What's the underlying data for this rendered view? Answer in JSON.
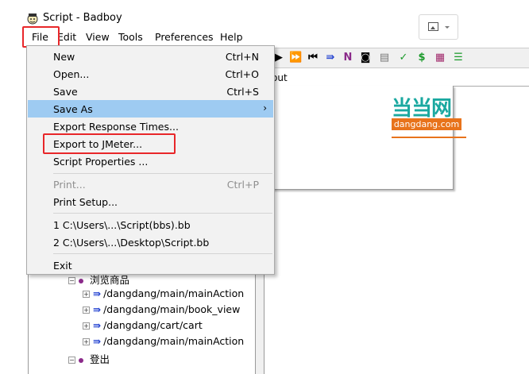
{
  "window": {
    "title": "Script - Badboy"
  },
  "menubar": {
    "file": "File",
    "edit": "Edit",
    "view": "View",
    "tools": "Tools",
    "preferences": "Preferences",
    "help": "Help"
  },
  "file_menu": {
    "items": [
      {
        "label": "New",
        "shortcut": "Ctrl+N"
      },
      {
        "label": "Open...",
        "shortcut": "Ctrl+O"
      },
      {
        "label": "Save",
        "shortcut": "Ctrl+S"
      },
      {
        "label": "Save As",
        "shortcut": ""
      },
      {
        "label": "Export Response Times...",
        "shortcut": ""
      },
      {
        "label": "Export to JMeter...",
        "shortcut": ""
      },
      {
        "label": "Script Properties ...",
        "shortcut": ""
      },
      {
        "label": "Print...",
        "shortcut": "Ctrl+P"
      },
      {
        "label": "Print Setup...",
        "shortcut": ""
      },
      {
        "label": "1 C:\\Users\\...\\Script(bbs).bb",
        "shortcut": ""
      },
      {
        "label": "2 C:\\Users\\...\\Desktop\\Script.bb",
        "shortcut": ""
      },
      {
        "label": "Exit",
        "shortcut": ""
      }
    ],
    "submenu_arrow": "›"
  },
  "tab": {
    "label": "out"
  },
  "logo": {
    "cn": "当当网",
    "en": "dangdang.com"
  },
  "tree": {
    "rows": [
      {
        "label": "浏览商品",
        "type": "group"
      },
      {
        "label": "/dangdang/main/mainAction",
        "type": "request"
      },
      {
        "label": "/dangdang/main/book_view",
        "type": "request"
      },
      {
        "label": "/dangdang/cart/cart",
        "type": "request"
      },
      {
        "label": "/dangdang/main/mainAction",
        "type": "request"
      },
      {
        "label": "登出",
        "type": "group"
      }
    ]
  },
  "toolbar_icons": [
    "play-icon",
    "fast-forward-icon",
    "skip-back-icon",
    "step-icon",
    "n-icon",
    "camera-icon",
    "page-icon",
    "check-icon",
    "dollar-icon",
    "grid-icon",
    "align-icon"
  ],
  "colors": {
    "highlight": "#9ecbf2",
    "annotation_red": "#e8272a",
    "logo_teal": "#1aa8a0",
    "logo_orange": "#e8731b"
  }
}
